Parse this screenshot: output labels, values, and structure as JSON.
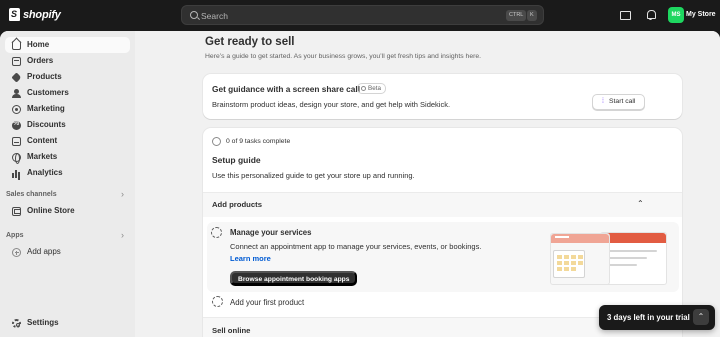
{
  "topbar": {
    "logo_text": "shopify",
    "search_placeholder": "Search",
    "kbd_ctrl": "CTRL",
    "kbd_k": "K",
    "avatar_initials": "MS",
    "store_name": "My Store"
  },
  "sidebar": {
    "items": [
      {
        "label": "Home",
        "icon": "home-icon",
        "active": true
      },
      {
        "label": "Orders",
        "icon": "orders-icon"
      },
      {
        "label": "Products",
        "icon": "tag-icon"
      },
      {
        "label": "Customers",
        "icon": "person-icon"
      },
      {
        "label": "Marketing",
        "icon": "target-icon"
      },
      {
        "label": "Discounts",
        "icon": "discount-icon"
      },
      {
        "label": "Content",
        "icon": "content-icon"
      },
      {
        "label": "Markets",
        "icon": "globe-icon"
      },
      {
        "label": "Analytics",
        "icon": "analytics-icon"
      }
    ],
    "sales_channels_label": "Sales channels",
    "online_store_label": "Online Store",
    "apps_label": "Apps",
    "add_apps_label": "Add apps",
    "settings_label": "Settings",
    "chevron": "›"
  },
  "main": {
    "title": "Get ready to sell",
    "subtitle": "Here’s a guide to get started. As your business grows, you’ll get fresh tips and insights here.",
    "guidance": {
      "title": "Get guidance with a screen share call",
      "badge": "Beta",
      "body": "Brainstorm product ideas, design your store, and get help with Sidekick.",
      "button": "Start call"
    },
    "setup": {
      "tasks_complete": "0 of 9 tasks complete",
      "title": "Setup guide",
      "subtitle": "Use this personalized guide to get your store up and running.",
      "add_products": "Add products",
      "task1": {
        "title": "Manage your services",
        "desc": "Connect an appointment app to manage your services, events, or bookings.",
        "link": "Learn more",
        "button": "Browse appointment booking apps"
      },
      "task2": "Add your first product",
      "sell_online": "Sell online"
    }
  },
  "trial": {
    "text": "3 days left in your trial",
    "chevron": "⌃"
  },
  "colors": {
    "accent_link": "#005bd3",
    "avatar": "#1ed760",
    "sidekick": "#8051ff"
  }
}
